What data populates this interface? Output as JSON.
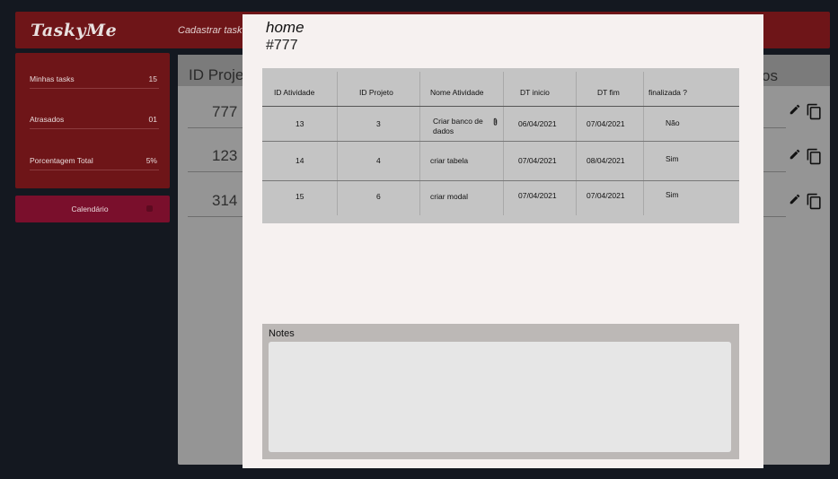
{
  "app": {
    "logo": "TaskyMe"
  },
  "topbar": {
    "nav_link": "Cadastrar task"
  },
  "stats": {
    "items": [
      {
        "label": "Minhas tasks",
        "value": "15"
      },
      {
        "label": "Atrasados",
        "value": "01"
      },
      {
        "label": "Porcentagem Total",
        "value": "5%"
      }
    ]
  },
  "sidebar": {
    "calendar_label": "Calendário"
  },
  "projects": {
    "header_left": "ID Projet",
    "header_right": "os",
    "rows": [
      {
        "id": "777"
      },
      {
        "id": "123"
      },
      {
        "id": "314"
      }
    ],
    "icons": {
      "edit": "pencil-icon",
      "copy": "copy-icon"
    }
  },
  "modal": {
    "title": "home",
    "subtitle": "#777",
    "table": {
      "headers": [
        "ID Atividade",
        "ID Projeto",
        "Nome Atividade",
        "DT inicio",
        "DT fim",
        "finalizada ?"
      ],
      "rows": [
        {
          "id_atividade": "13",
          "id_projeto": "3",
          "nome": "Criar banco de dados",
          "dt_inicio": "06/04/2021",
          "dt_fim": "07/04/2021",
          "finalizada": "Não"
        },
        {
          "id_atividade": "14",
          "id_projeto": "4",
          "nome": "criar tabela",
          "dt_inicio": "07/04/2021",
          "dt_fim": "08/04/2021",
          "finalizada": "Sim"
        },
        {
          "id_atividade": "15",
          "id_projeto": "6",
          "nome": "criar modal",
          "dt_inicio": "07/04/2021",
          "dt_fim": "07/04/2021",
          "finalizada": "Sim"
        }
      ],
      "attachment_icon": "paperclip-icon"
    },
    "notes": {
      "label": "Notes",
      "value": ""
    }
  },
  "colors": {
    "brand": "#6e1518",
    "calendar": "#7a0f2c",
    "background": "#141820",
    "modal": "#f6f1f0",
    "table": "#c4c4c4"
  }
}
